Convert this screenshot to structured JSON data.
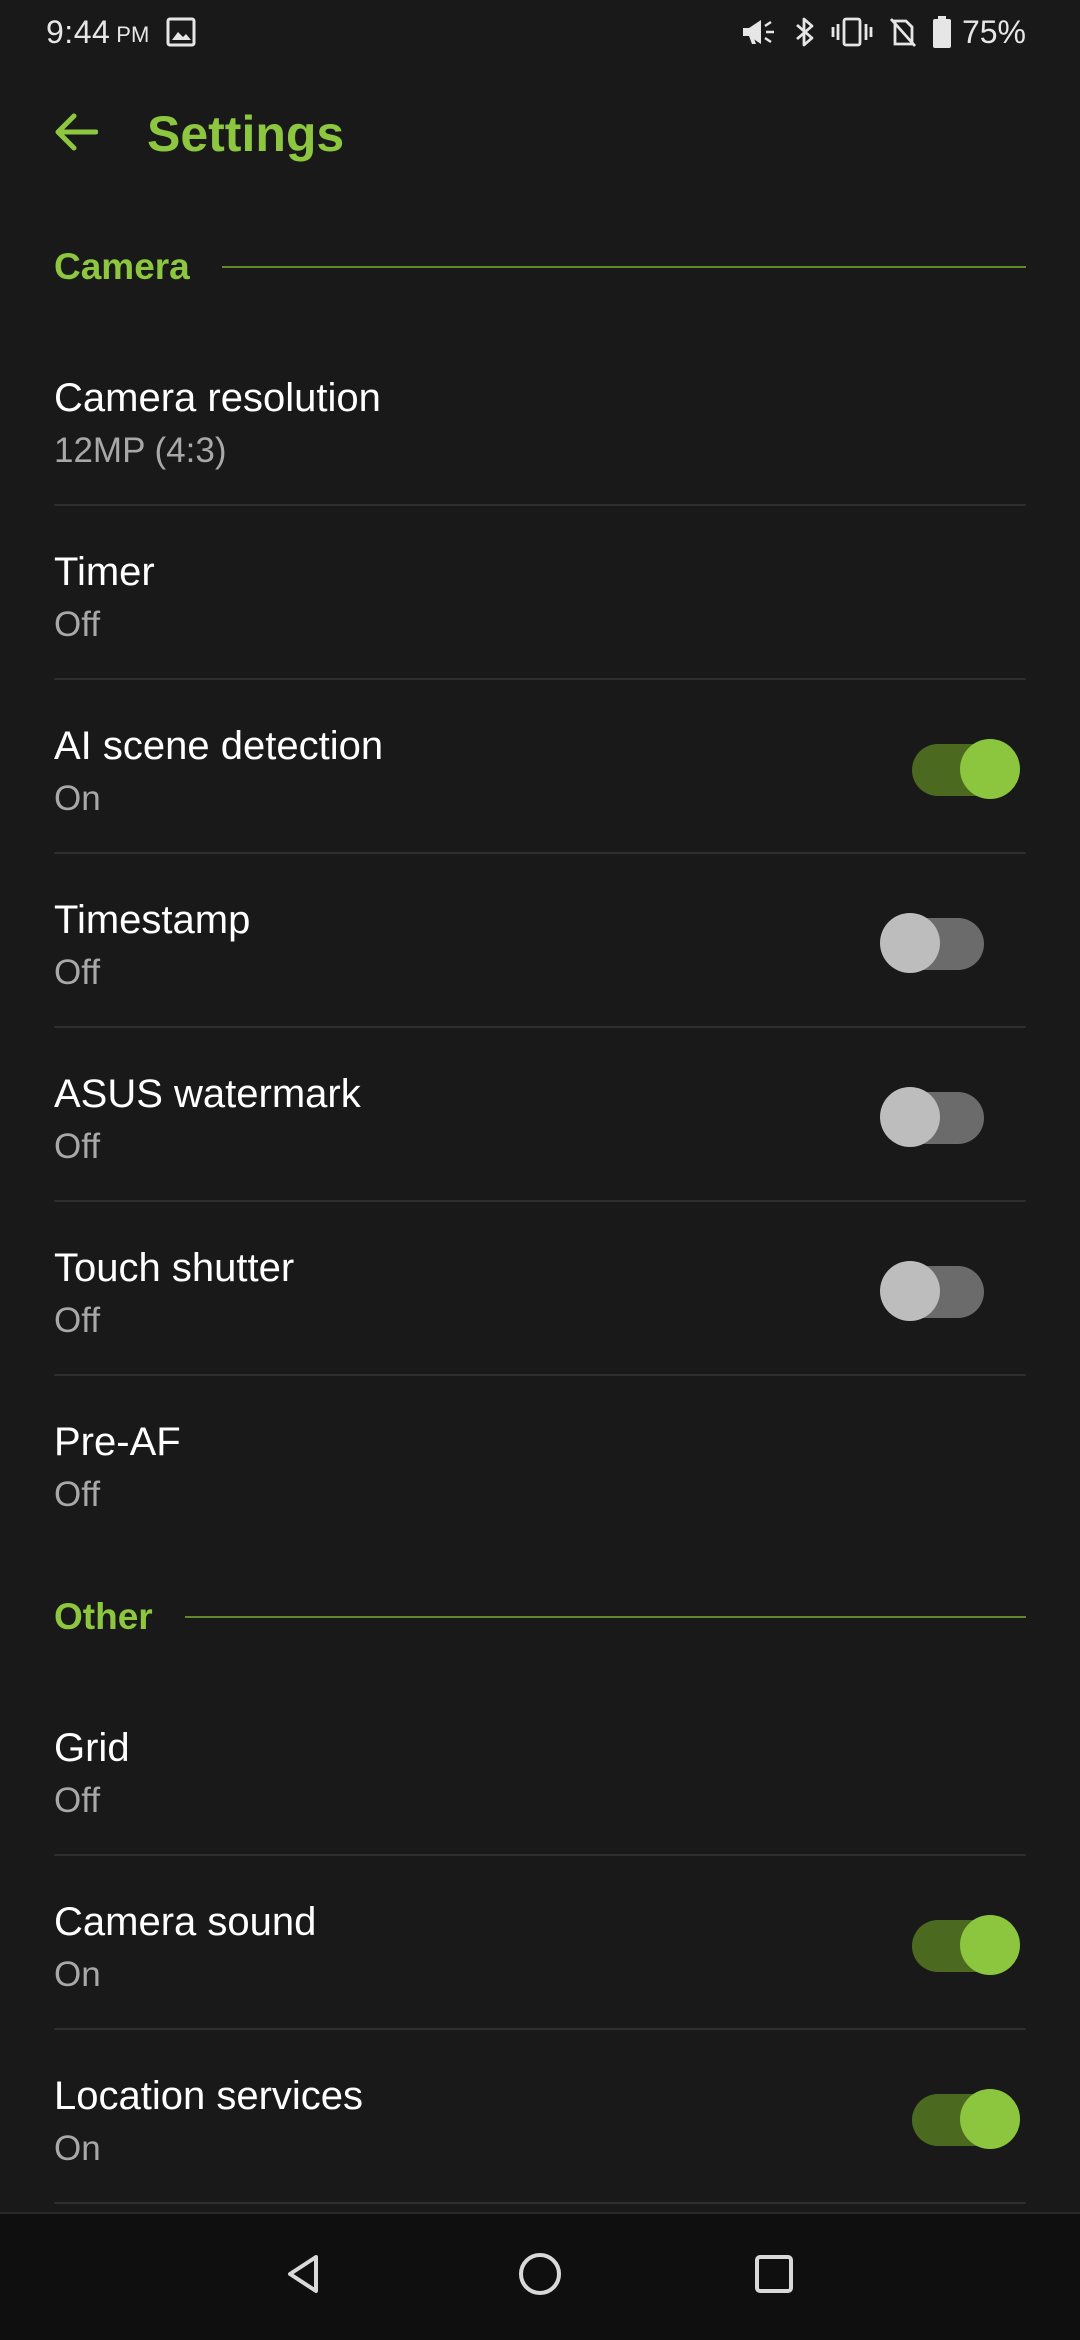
{
  "status_bar": {
    "time": "9:44",
    "ampm": "PM",
    "battery": "75%",
    "icons": [
      "image-icon",
      "megaphone-icon",
      "bluetooth-icon",
      "vibrate-icon",
      "no-sim-icon",
      "battery-icon"
    ]
  },
  "appbar": {
    "title": "Settings",
    "back_icon": "arrow-back-icon"
  },
  "sections": [
    {
      "label": "Camera",
      "items": [
        {
          "title": "Camera resolution",
          "value": "12MP (4:3)",
          "toggle": null
        },
        {
          "title": "Timer",
          "value": "Off",
          "toggle": null
        },
        {
          "title": "AI scene detection",
          "value": "On",
          "toggle": true
        },
        {
          "title": "Timestamp",
          "value": "Off",
          "toggle": false
        },
        {
          "title": "ASUS watermark",
          "value": "Off",
          "toggle": false
        },
        {
          "title": "Touch shutter",
          "value": "Off",
          "toggle": false
        },
        {
          "title": "Pre-AF",
          "value": "Off",
          "toggle": null
        }
      ]
    },
    {
      "label": "Other",
      "items": [
        {
          "title": "Grid",
          "value": "Off",
          "toggle": null
        },
        {
          "title": "Camera sound",
          "value": "On",
          "toggle": true
        },
        {
          "title": "Location services",
          "value": "On",
          "toggle": true
        }
      ]
    }
  ],
  "navbar": {
    "buttons": [
      "back-triangle-icon",
      "home-circle-icon",
      "recents-square-icon"
    ]
  },
  "colors": {
    "accent": "#8dc63f",
    "background": "#191919",
    "switch_on_track": "#4b6a1f",
    "switch_off_track": "#6b6b6b"
  }
}
